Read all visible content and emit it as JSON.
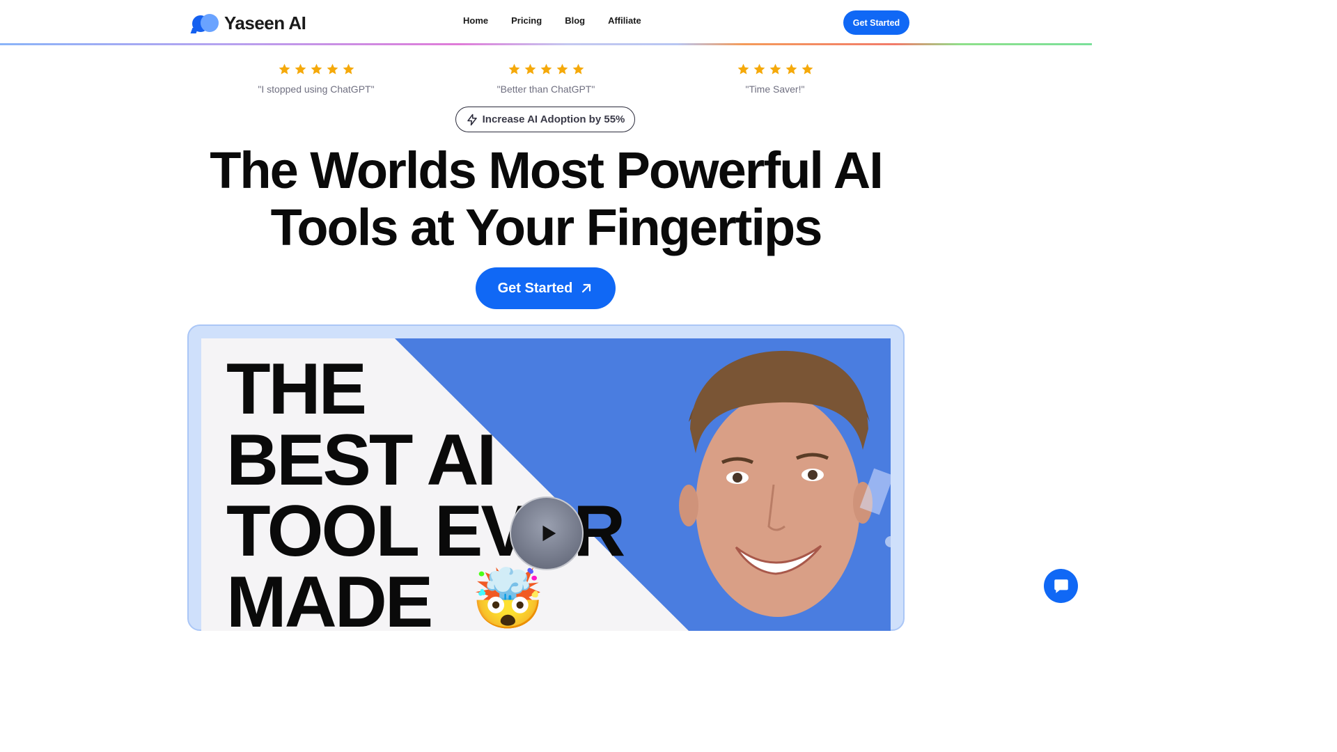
{
  "brand": {
    "name": "Yaseen AI",
    "accent": "#1068f5",
    "logo_icon": "chat-bubbles-logo"
  },
  "nav": {
    "items": [
      {
        "label": "Home"
      },
      {
        "label": "Pricing"
      },
      {
        "label": "Blog"
      },
      {
        "label": "Affiliate"
      }
    ]
  },
  "header": {
    "cta_label": "Get Started"
  },
  "testimonials": [
    {
      "rating": 5,
      "quote": "\"I stopped using ChatGPT\""
    },
    {
      "rating": 5,
      "quote": "\"Better than ChatGPT\""
    },
    {
      "rating": 5,
      "quote": "\"Time Saver!\""
    }
  ],
  "badge": {
    "icon": "lightning-icon",
    "label": "Increase AI Adoption by 55%"
  },
  "hero": {
    "headline_line1": "The Worlds Most Powerful AI",
    "headline_line2": "Tools at Your Fingertips",
    "cta_label": "Get Started",
    "cta_icon": "arrow-up-right-icon"
  },
  "video": {
    "thumbnail_lines": [
      "THE",
      "BEST AI",
      "TOOL EVER",
      "MADE"
    ],
    "emoji": "🤯",
    "play_icon": "play-icon",
    "colors": {
      "panel": "#4a7de0",
      "background": "#f5f4f6"
    }
  },
  "chat_widget": {
    "icon": "chat-icon"
  }
}
